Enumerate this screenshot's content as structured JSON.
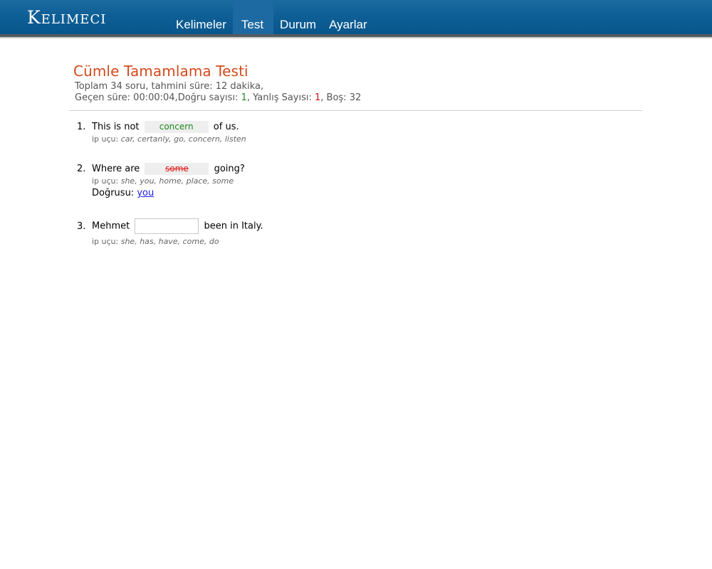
{
  "header": {
    "logo": "Kelimeci",
    "nav": [
      "Kelimeler",
      "Test",
      "Durum",
      "Ayarlar"
    ]
  },
  "test": {
    "title": "Cümle Tamamlama Testi",
    "summary": "Toplam 34 soru, tahmini süre: 12 dakika,",
    "elapsed_label": "Geçen süre: 00:00:04,Doğru sayısı: ",
    "correct_count": "1",
    "wrong_label": ", Yanlış Sayısı: ",
    "wrong_count": "1",
    "blank_label": ", Boş: 32"
  },
  "questions": [
    {
      "number": "1.",
      "before": "This is not",
      "answer": "concern",
      "after": "of us.",
      "hint_label": "ip uçu:",
      "hint_words": "car, certanly, go, concern, listen"
    },
    {
      "number": "2.",
      "before": "Where are",
      "answer": "some",
      "after": "going?",
      "hint_label": "ip uçu:",
      "hint_words": "she, you, home, place, some",
      "correct_label": "Doğrusu:",
      "correct_answer": "you"
    },
    {
      "number": "3.",
      "before": "Mehmet",
      "input_value": "",
      "after": "been in Italy.",
      "hint_label": "ip uçu:",
      "hint_words": "she, has, have, come, do"
    }
  ],
  "colors": {
    "header": "#0f5f97",
    "title": "#d24a1c",
    "correct": "#1a8a1a",
    "wrong": "#e01b1b",
    "link": "#1a1aee"
  }
}
